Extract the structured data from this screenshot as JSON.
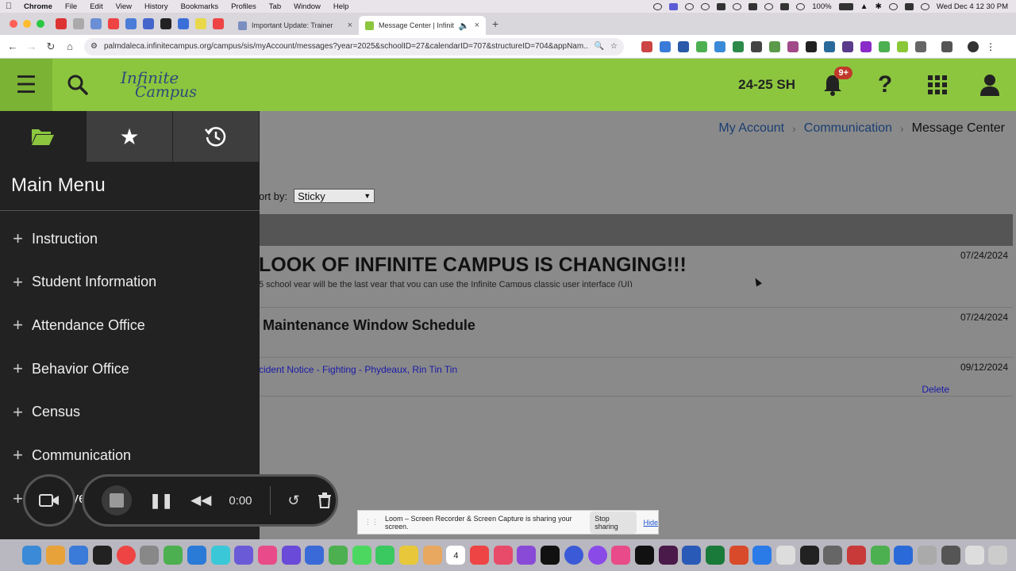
{
  "menubar": {
    "app": "Chrome",
    "items": [
      "File",
      "Edit",
      "View",
      "History",
      "Bookmarks",
      "Profiles",
      "Tab",
      "Window",
      "Help"
    ],
    "battery": "100%",
    "datetime": "Wed Dec 4  12 30 PM"
  },
  "tabs": [
    {
      "title": "Important Update: Trainer",
      "active": false
    },
    {
      "title": "Message Center | Infinite",
      "active": true
    }
  ],
  "address": {
    "url": "palmdaleca.infinitecampus.org/campus/sis/myAccount/messages?year=2025&schoolID=27&calendarID=707&structureID=704&appNam..."
  },
  "header": {
    "logo_line1": "Infinite",
    "logo_line2": "Campus",
    "term": "24-25 SH",
    "notifications_badge": "9+"
  },
  "breadcrumb": {
    "items": [
      "My Account",
      "Communication",
      "Message Center"
    ]
  },
  "sort": {
    "label": "ort by:",
    "value": "Sticky"
  },
  "messages": [
    {
      "title": "LOOK OF INFINITE CAMPUS IS CHANGING!!!",
      "body": "5 school year will be the last year that you can use the Infinite Campus classic user interface (UI)",
      "date": "07/24/2024"
    },
    {
      "title": "Maintenance Window Schedule",
      "date": "07/24/2024"
    },
    {
      "link": "cident Notice - Fighting - Phydeaux, Rin Tin Tin",
      "date": "09/12/2024",
      "delete_label": "Delete"
    }
  ],
  "sidebar": {
    "title": "Main Menu",
    "items": [
      "Instruction",
      "Student Information",
      "Attendance Office",
      "Behavior Office",
      "Census",
      "Communication",
      "ye"
    ]
  },
  "loom": {
    "time": "0:00",
    "share_text": "Loom – Screen Recorder & Screen Capture is sharing your screen.",
    "stop_label": "Stop sharing",
    "hide_label": "Hide",
    "dock_date": "4"
  },
  "colors": {
    "header_green": "#8cc63f",
    "sidebar_dark": "#222222",
    "link_blue": "#1b3e72"
  }
}
